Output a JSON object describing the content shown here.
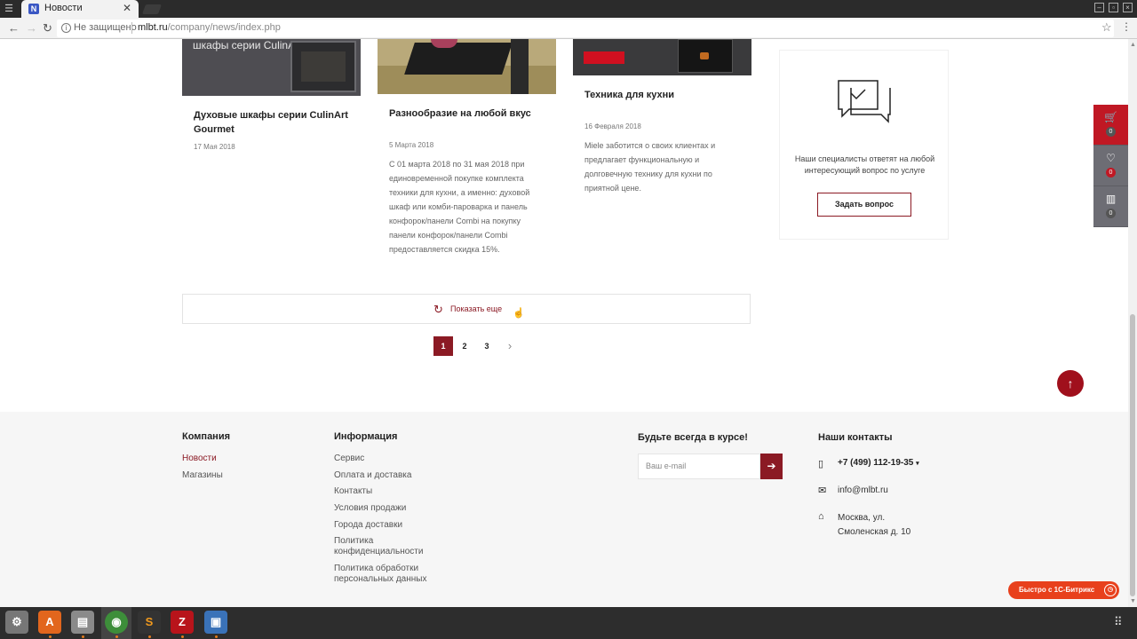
{
  "browser": {
    "tab_favicon": "N",
    "tab_title": "Новости",
    "tab_close": "✕",
    "not_secure": "Не защищено",
    "url_domain": "mlbt.ru",
    "url_path": "/company/news/index.php"
  },
  "news": [
    {
      "image_caption": "шкафы серии CulinArt Gourmet",
      "title": "Духовые шкафы серии CulinArt Gourmet",
      "date": "17 Мая 2018",
      "text": ""
    },
    {
      "image_caption": "",
      "title": "Разнообразие на любой вкус",
      "date": "5 Марта 2018",
      "text": "С 01 марта 2018 по 31 мая 2018 при единовременной покупке комплекта техники для кухни, а именно: духовой шкаф или комби-пароварка и панель конфорок/панели Combi на покупку панели конфорок/панели Combi предоставляется скидка 15%."
    },
    {
      "image_caption": "",
      "title": "Техника для кухни",
      "date": "16 Февраля 2018",
      "text": "Miele заботится о своих клиентах и предлагает функциональную и долговечную технику для кухни по приятной цене."
    }
  ],
  "ask": {
    "text": "Наши специалисты ответят на любой интересующий вопрос по услуге",
    "button": "Задать вопрос"
  },
  "side_panel": {
    "cart_count": "0",
    "favorites_count": "0",
    "compare_count": "0"
  },
  "show_more": "Показать еще",
  "pagination": {
    "pages": [
      "1",
      "2",
      "3"
    ],
    "active": "1",
    "next": "›"
  },
  "footer": {
    "company": {
      "heading": "Компания",
      "links": [
        "Новости",
        "Магазины"
      ]
    },
    "info": {
      "heading": "Информация",
      "links": [
        "Сервис",
        "Оплата и доставка",
        "Контакты",
        "Условия продажи",
        "Города доставки",
        "Политика конфиденциальности",
        "Политика обработки персональных данных"
      ]
    },
    "subscribe": {
      "heading": "Будьте всегда в курсе!",
      "placeholder": "Ваш e-mail"
    },
    "contacts": {
      "heading": "Наши контакты",
      "phone": "+7 (499) 112-19-35",
      "email": "info@mlbt.ru",
      "address": "Москва, ул. Смоленская д. 10"
    }
  },
  "bitrix_label": "Быстро с 1С-Битрикс",
  "colors": {
    "accent": "#8b1a24",
    "cart_red": "#c01824",
    "panel_gray": "#6d6d74"
  },
  "icons": [
    "chat-icon",
    "cart-icon",
    "heart-icon",
    "chart-icon",
    "refresh-icon",
    "arrow-up-icon",
    "arrow-right-icon",
    "phone-icon",
    "mail-icon",
    "location-icon"
  ]
}
